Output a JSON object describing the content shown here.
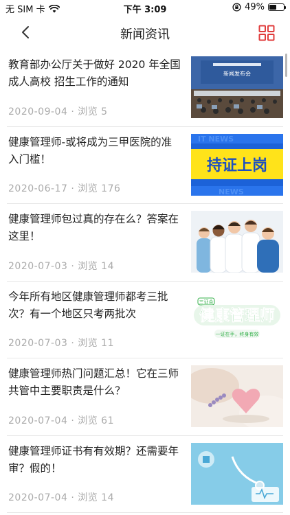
{
  "status_bar": {
    "carrier": "无 SIM 卡",
    "time": "下午 3:09",
    "battery": "49%",
    "battery_level": 0.49
  },
  "nav": {
    "title": "新闻资讯",
    "accent_color": "#e03c3c"
  },
  "news": [
    {
      "title": "教育部办公厅关于做好 2020 年全国成人高校 招生工作的通知",
      "date": "2020-09-04",
      "views": "浏览 5",
      "thumb_icon": "conference-photo",
      "thumb_caption": "新闻发布会"
    },
    {
      "title": "健康管理师-或将成为三甲医院的准入门槛！",
      "date": "2020-06-17",
      "views": "浏览 176",
      "thumb_icon": "certificate-banner",
      "thumb_caption": "持证上岗"
    },
    {
      "title": "健康管理师包过真的存在么？答案在这里！",
      "date": "2020-07-03",
      "views": "浏览 14",
      "thumb_icon": "doctors-photo",
      "thumb_caption": ""
    },
    {
      "title": "今年所有地区健康管理师都考三批次？有一个地区只考两批次",
      "date": "2020-07-03",
      "views": "浏览 11",
      "thumb_icon": "health-manager-logo",
      "thumb_caption": "健康管理师",
      "thumb_badge": "三证合",
      "thumb_sub": "一证在手，终身有效"
    },
    {
      "title": "健康管理师热门问题汇总！它在三师共管中主要职责是什么？",
      "date": "2020-07-04",
      "views": "浏览 61",
      "thumb_icon": "heart-stone-photo",
      "thumb_caption": ""
    },
    {
      "title": "健康管理师证书有有效期？还需要年审？假的！",
      "date": "2020-07-04",
      "views": "浏览 14",
      "thumb_icon": "medical-stethoscope-photo",
      "thumb_caption": ""
    }
  ]
}
